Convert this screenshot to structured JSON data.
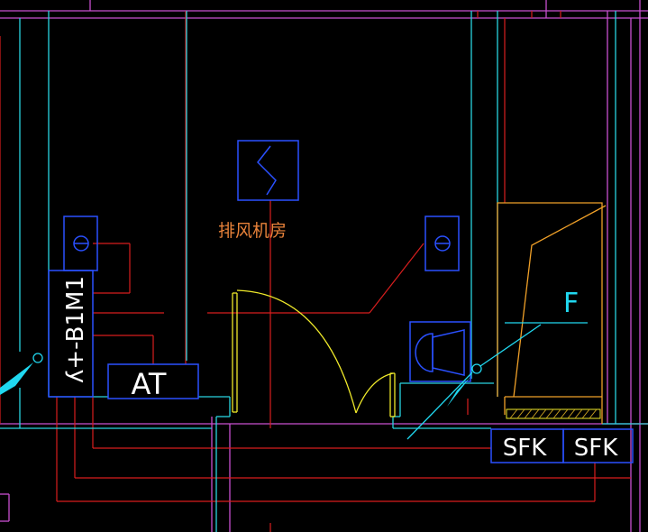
{
  "colors": {
    "background": "#000000",
    "wall_cyan": "#29d4e0",
    "wall_magenta": "#c84fd0",
    "pipe_red": "#d81e1e",
    "equipment_blue": "#2a50ff",
    "door_yellow": "#f0ea2a",
    "shaft_orange": "#f0a028",
    "text_white": "#ffffff",
    "room_label": "#e8823a",
    "section_cyan": "#20d8f0"
  },
  "labels": {
    "room_name": "排风机房",
    "panel_id": "ʎ+-B1M1",
    "at_box": "AT",
    "sfk_left": "SFK",
    "sfk_right": "SFK",
    "section_mark": "F"
  },
  "icons": {
    "fan_symbol": "exhaust-fan-icon",
    "outlet_left": "outlet-icon",
    "outlet_right": "outlet-icon",
    "speaker": "speaker-icon",
    "section_arrow_left": "section-arrow-icon",
    "section_arrow_right": "section-arrow-icon"
  }
}
